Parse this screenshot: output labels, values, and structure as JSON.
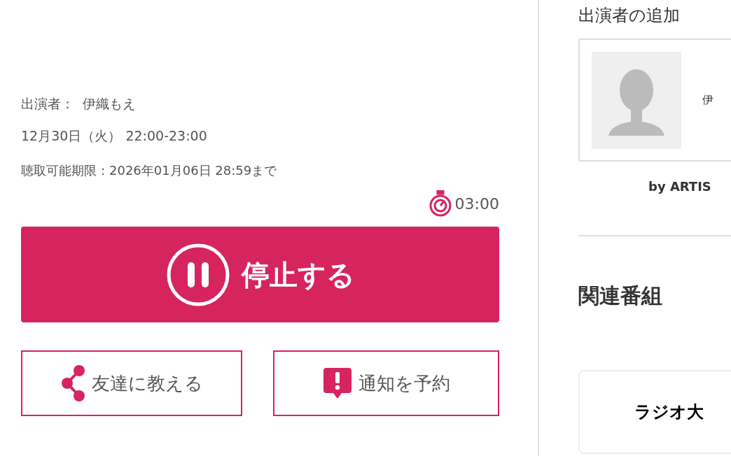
{
  "program": {
    "performer_label": "出演者：",
    "performer": "伊織もえ",
    "schedule": "12月30日（火） 22:00-23:00",
    "deadline": "聴取可能期限：2026年01月06日 28:59まで",
    "timer": "03:00"
  },
  "player": {
    "playing": true,
    "label": "停止する"
  },
  "actions": [
    {
      "kind": "share",
      "label": "友達に教える"
    },
    {
      "kind": "notify",
      "label": "通知を予約"
    }
  ],
  "sidebar": {
    "heading": "出演者の追加",
    "performer_card": {
      "name": "伊"
    },
    "credit": "by ARTIS",
    "related_heading": "関連番組",
    "related_card": {
      "station": "ラジオ大"
    }
  }
}
